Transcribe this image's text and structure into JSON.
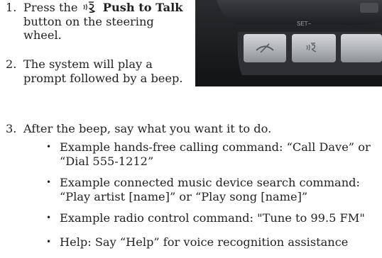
{
  "steps": [
    {
      "number": "1.",
      "before": "Press the",
      "button_name": "Push to Talk",
      "after": "button on the steering wheel."
    },
    {
      "number": "2.",
      "text": "The system will play a prompt followed by a beep."
    },
    {
      "number": "3.",
      "text": "After the beep, say what you want it to do."
    }
  ],
  "bullets": [
    "Example hands-free calling command: “Call Dave” or “Dial 555-1212”",
    "Example connected music device search command: “Play artist [name]” or “Play song [name]”",
    "Example radio control command: \"Tune to 99.5 FM\"",
    "Help: Say “Help” for voice recognition assistance"
  ],
  "photo": {
    "button_label": "SET−"
  },
  "icons": {
    "inline": "push-to-talk-icon",
    "photo_left_button": "hang-up-icon",
    "photo_right_button": "push-to-talk-icon"
  }
}
